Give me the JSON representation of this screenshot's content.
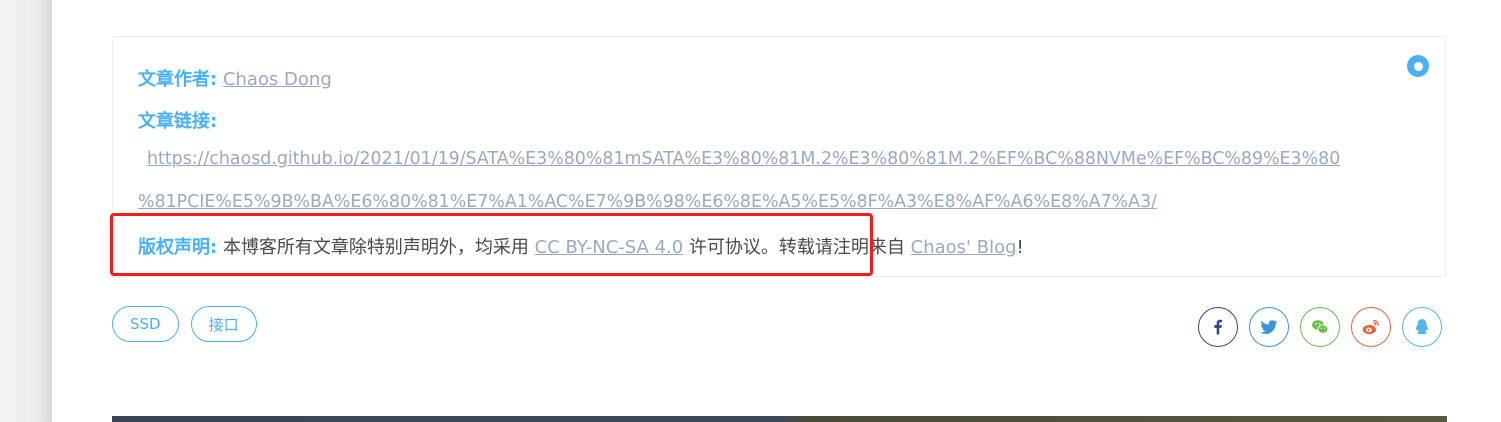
{
  "post_copyright": {
    "author_label": "文章作者:",
    "author_name": "Chaos Dong",
    "link_label": "文章链接:",
    "link_line1": "https://chaosd.github.io/2021/01/19/SATA%E3%80%81mSATA%E3%80%81M.2%E3%80%81M.2%EF%BC%88NVMe%EF%BC%89%E3%80",
    "link_line2": "%81PCIE%E5%9B%BA%E6%80%81%E7%A1%AC%E7%9B%98%E6%8E%A5%E5%8F%A3%E8%AF%A6%E8%A7%A3/",
    "license_label": "版权声明:",
    "license_text_before": "本博客所有文章除特别声明外，均采用 ",
    "license_name": "CC BY-NC-SA 4.0",
    "license_text_middle": " 许可协议。转载请注明来自 ",
    "blog_name": "Chaos' Blog",
    "license_text_after": "!"
  },
  "tags": [
    "SSD",
    "接口"
  ],
  "share": [
    {
      "name": "facebook-icon",
      "color": "#2f4a8c"
    },
    {
      "name": "twitter-icon",
      "color": "#3a96d8"
    },
    {
      "name": "wechat-icon",
      "color": "#6bbf4a"
    },
    {
      "name": "weibo-icon",
      "color": "#e8643a"
    },
    {
      "name": "qq-icon",
      "color": "#52b6e8"
    }
  ],
  "colors": {
    "accent": "#49b1f5",
    "link": "#99a9bf",
    "highlight": "#f21d1d"
  }
}
